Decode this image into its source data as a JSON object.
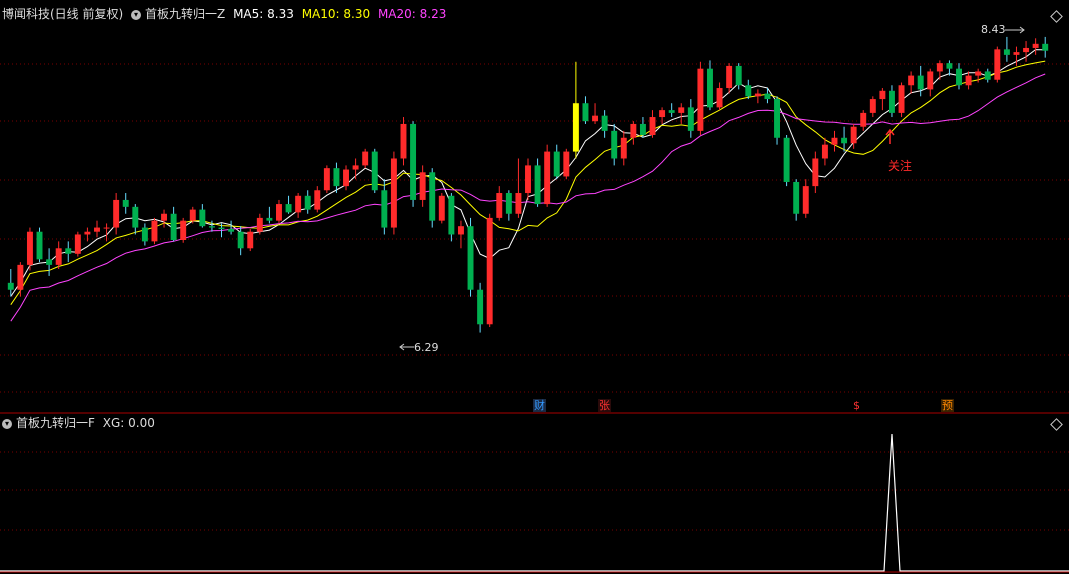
{
  "header": {
    "stock_title": "博闻科技(日线 前复权)",
    "indicator_main": "首板九转归一Z",
    "ma5": {
      "label": "MA5:",
      "value": "8.33",
      "color": "#ffffff"
    },
    "ma10": {
      "label": "MA10:",
      "value": "8.30",
      "color": "#ffff00"
    },
    "ma20": {
      "label": "MA20:",
      "value": "8.23",
      "color": "#ff44ff"
    }
  },
  "sub_header": {
    "indicator": "首板九转归一F",
    "xg_label": "XG:",
    "xg_value": "0.00"
  },
  "annotations": {
    "high_label": "8.43",
    "low_label": "6.29",
    "focus_label": "关注"
  },
  "event_badges": [
    {
      "text": "财",
      "color": "#3399ff"
    },
    {
      "text": "张",
      "color": "#ff3333"
    },
    {
      "text": "$",
      "color": "#ff3333"
    },
    {
      "text": "预",
      "color": "#ff8800"
    }
  ],
  "colors": {
    "up": "#ff2b2b",
    "down": "#00b050",
    "grid": "#7a0000",
    "highlight": "#ffff00",
    "signal": "#ffffff"
  },
  "chart_data": {
    "type": "candlestick",
    "y_scale_hint": {
      "low": 6.29,
      "high": 8.43
    },
    "candles": [
      [
        6.65,
        6.75,
        6.55,
        6.6
      ],
      [
        6.6,
        6.8,
        6.55,
        6.78
      ],
      [
        6.78,
        7.05,
        6.74,
        7.02
      ],
      [
        7.02,
        7.05,
        6.8,
        6.82
      ],
      [
        6.82,
        6.9,
        6.7,
        6.78
      ],
      [
        6.78,
        6.95,
        6.75,
        6.9
      ],
      [
        6.9,
        6.95,
        6.8,
        6.86
      ],
      [
        6.86,
        7.02,
        6.84,
        7.0
      ],
      [
        7.0,
        7.05,
        6.95,
        7.02
      ],
      [
        7.02,
        7.1,
        6.98,
        7.05
      ],
      [
        7.05,
        7.08,
        6.95,
        7.05
      ],
      [
        7.05,
        7.3,
        7.0,
        7.25
      ],
      [
        7.25,
        7.3,
        7.15,
        7.2
      ],
      [
        7.2,
        7.22,
        7.0,
        7.05
      ],
      [
        7.05,
        7.08,
        6.92,
        6.95
      ],
      [
        6.95,
        7.12,
        6.93,
        7.1
      ],
      [
        7.1,
        7.18,
        7.05,
        7.15
      ],
      [
        7.15,
        7.2,
        6.95,
        6.96
      ],
      [
        6.96,
        7.12,
        6.94,
        7.1
      ],
      [
        7.1,
        7.2,
        7.08,
        7.18
      ],
      [
        7.18,
        7.22,
        7.05,
        7.06
      ],
      [
        7.06,
        7.1,
        7.02,
        7.05
      ],
      [
        7.05,
        7.08,
        6.98,
        7.04
      ],
      [
        7.04,
        7.1,
        7.0,
        7.02
      ],
      [
        7.02,
        7.06,
        6.85,
        6.9
      ],
      [
        6.9,
        7.04,
        6.88,
        7.02
      ],
      [
        7.02,
        7.15,
        7.0,
        7.12
      ],
      [
        7.12,
        7.2,
        7.08,
        7.1
      ],
      [
        7.1,
        7.25,
        7.08,
        7.22
      ],
      [
        7.22,
        7.28,
        7.15,
        7.16
      ],
      [
        7.16,
        7.3,
        7.12,
        7.28
      ],
      [
        7.28,
        7.32,
        7.15,
        7.18
      ],
      [
        7.18,
        7.35,
        7.16,
        7.32
      ],
      [
        7.32,
        7.5,
        7.3,
        7.48
      ],
      [
        7.48,
        7.52,
        7.3,
        7.35
      ],
      [
        7.35,
        7.5,
        7.32,
        7.47
      ],
      [
        7.47,
        7.55,
        7.4,
        7.5
      ],
      [
        7.5,
        7.62,
        7.48,
        7.6
      ],
      [
        7.6,
        7.62,
        7.3,
        7.32
      ],
      [
        7.32,
        7.4,
        7.0,
        7.05
      ],
      [
        7.05,
        7.6,
        7.0,
        7.55
      ],
      [
        7.55,
        7.85,
        7.5,
        7.8
      ],
      [
        7.8,
        7.82,
        7.2,
        7.25
      ],
      [
        7.25,
        7.5,
        7.2,
        7.45
      ],
      [
        7.45,
        7.48,
        7.05,
        7.1
      ],
      [
        7.1,
        7.3,
        7.08,
        7.28
      ],
      [
        7.28,
        7.3,
        6.95,
        7.0
      ],
      [
        7.0,
        7.1,
        6.9,
        7.06
      ],
      [
        7.06,
        7.12,
        6.55,
        6.6
      ],
      [
        6.6,
        6.65,
        6.29,
        6.35
      ],
      [
        6.35,
        7.15,
        6.33,
        7.12
      ],
      [
        7.12,
        7.35,
        7.1,
        7.3
      ],
      [
        7.3,
        7.32,
        7.1,
        7.15
      ],
      [
        7.15,
        7.55,
        7.12,
        7.3
      ],
      [
        7.3,
        7.55,
        7.25,
        7.5
      ],
      [
        7.5,
        7.55,
        7.2,
        7.22
      ],
      [
        7.22,
        7.65,
        7.2,
        7.6
      ],
      [
        7.6,
        7.65,
        7.4,
        7.42
      ],
      [
        7.42,
        7.62,
        7.4,
        7.6
      ],
      [
        7.6,
        8.25,
        7.55,
        7.95
      ],
      [
        7.95,
        8.0,
        7.8,
        7.82
      ],
      [
        7.82,
        7.95,
        7.8,
        7.86
      ],
      [
        7.86,
        7.9,
        7.7,
        7.75
      ],
      [
        7.75,
        7.8,
        7.5,
        7.55
      ],
      [
        7.55,
        7.75,
        7.5,
        7.7
      ],
      [
        7.7,
        7.82,
        7.65,
        7.8
      ],
      [
        7.8,
        7.85,
        7.7,
        7.72
      ],
      [
        7.72,
        7.9,
        7.7,
        7.85
      ],
      [
        7.85,
        7.92,
        7.8,
        7.9
      ],
      [
        7.9,
        7.95,
        7.85,
        7.88
      ],
      [
        7.88,
        7.95,
        7.8,
        7.92
      ],
      [
        7.92,
        7.98,
        7.7,
        7.75
      ],
      [
        7.75,
        8.25,
        7.72,
        8.2
      ],
      [
        8.2,
        8.26,
        7.9,
        7.92
      ],
      [
        7.92,
        8.1,
        7.9,
        8.06
      ],
      [
        8.06,
        8.24,
        8.02,
        8.22
      ],
      [
        8.22,
        8.24,
        8.05,
        8.08
      ],
      [
        8.08,
        8.12,
        7.98,
        8.0
      ],
      [
        8.0,
        8.05,
        7.95,
        8.02
      ],
      [
        8.02,
        8.06,
        7.95,
        7.98
      ],
      [
        7.98,
        8.0,
        7.65,
        7.7
      ],
      [
        7.7,
        7.72,
        7.35,
        7.38
      ],
      [
        7.38,
        7.4,
        7.1,
        7.15
      ],
      [
        7.15,
        7.4,
        7.12,
        7.35
      ],
      [
        7.35,
        7.6,
        7.3,
        7.55
      ],
      [
        7.55,
        7.7,
        7.5,
        7.65
      ],
      [
        7.65,
        7.75,
        7.6,
        7.7
      ],
      [
        7.7,
        7.78,
        7.6,
        7.66
      ],
      [
        7.66,
        7.8,
        7.62,
        7.78
      ],
      [
        7.78,
        7.9,
        7.75,
        7.88
      ],
      [
        7.88,
        8.0,
        7.85,
        7.98
      ],
      [
        7.98,
        8.06,
        7.9,
        8.04
      ],
      [
        8.04,
        8.08,
        7.85,
        7.88
      ],
      [
        7.88,
        8.1,
        7.85,
        8.08
      ],
      [
        8.08,
        8.18,
        8.02,
        8.15
      ],
      [
        8.15,
        8.22,
        8.0,
        8.05
      ],
      [
        8.05,
        8.2,
        8.0,
        8.18
      ],
      [
        8.18,
        8.26,
        8.12,
        8.24
      ],
      [
        8.24,
        8.26,
        8.15,
        8.2
      ],
      [
        8.2,
        8.24,
        8.05,
        8.08
      ],
      [
        8.08,
        8.18,
        8.05,
        8.15
      ],
      [
        8.15,
        8.2,
        8.1,
        8.18
      ],
      [
        8.18,
        8.2,
        8.1,
        8.12
      ],
      [
        8.12,
        8.36,
        8.1,
        8.34
      ],
      [
        8.34,
        8.43,
        8.25,
        8.3
      ],
      [
        8.3,
        8.36,
        8.22,
        8.32
      ],
      [
        8.32,
        8.4,
        8.25,
        8.35
      ],
      [
        8.35,
        8.42,
        8.3,
        8.38
      ],
      [
        8.38,
        8.43,
        8.28,
        8.33
      ]
    ],
    "highlight_candle_index": 59,
    "signal_index": 92
  }
}
